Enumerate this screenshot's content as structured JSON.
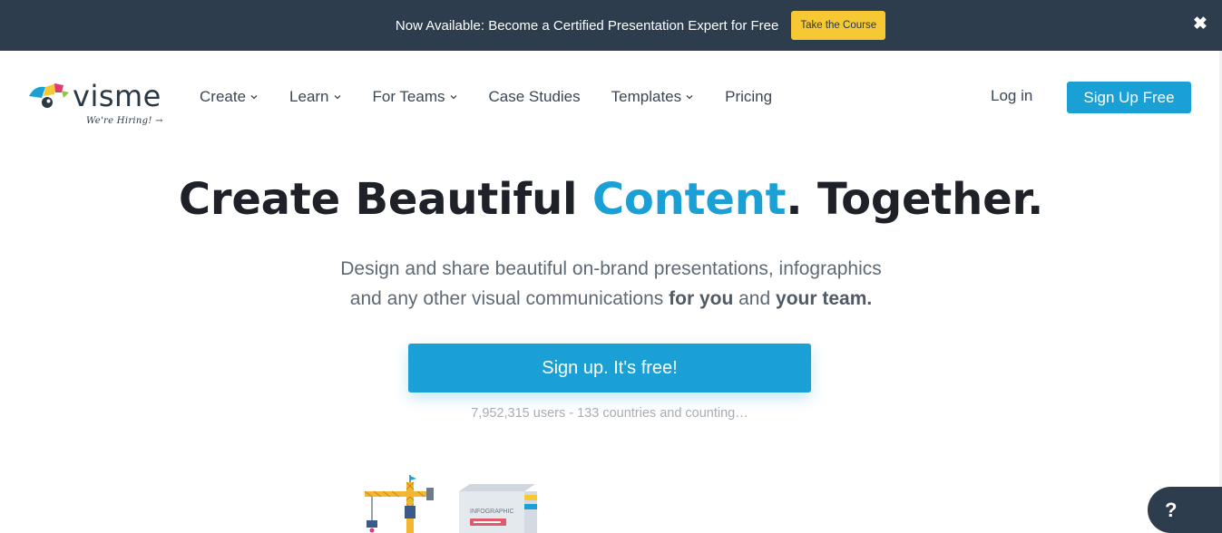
{
  "announcement": {
    "text": "Now Available: Become a Certified Presentation Expert for Free",
    "button": "Take the Course",
    "close_icon": "close-icon"
  },
  "logo": {
    "wordmark": "visme",
    "tagline": "We're Hiring! →"
  },
  "nav": {
    "items": [
      {
        "label": "Create",
        "dropdown": true
      },
      {
        "label": "Learn",
        "dropdown": true
      },
      {
        "label": "For Teams",
        "dropdown": true
      },
      {
        "label": "Case Studies",
        "dropdown": false
      },
      {
        "label": "Templates",
        "dropdown": true
      },
      {
        "label": "Pricing",
        "dropdown": false
      }
    ],
    "login": "Log in",
    "signup": "Sign Up Free"
  },
  "hero": {
    "title_part1": "Create Beautiful ",
    "title_accent": "Content",
    "title_part2": ". Together.",
    "sub_line1": "Design and share beautiful on-brand presentations, infographics",
    "sub_line2_a": "and any other visual communications ",
    "sub_line2_b": "for you",
    "sub_line2_c": " and ",
    "sub_line2_d": "your team.",
    "cta": "Sign up. It's free!",
    "counter": "7,952,315 users - 133 countries and counting…"
  },
  "illustration": {
    "box_label": "INFOGRAPHIC"
  },
  "help": {
    "label": "?"
  },
  "colors": {
    "accent": "#1aa0d4",
    "dark": "#2e3d4e",
    "yellow": "#f6c934"
  }
}
